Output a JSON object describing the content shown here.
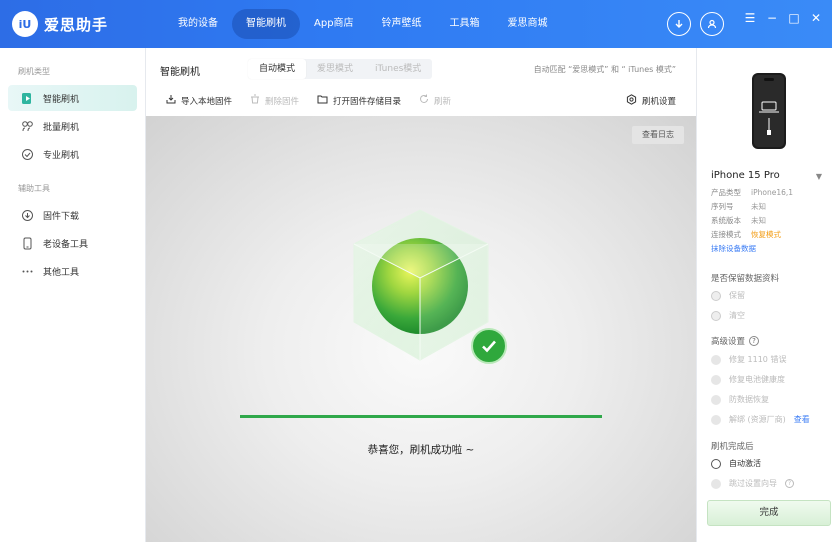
{
  "app": {
    "logo_badge": "iU",
    "name": "爱思助手",
    "nav_tabs": [
      "我的设备",
      "智能刷机",
      "App商店",
      "铃声壁纸",
      "工具箱",
      "爱思商城"
    ],
    "active_tab": "智能刷机",
    "accent": "#2f7af2"
  },
  "sidebar": {
    "section1": "刷机类型",
    "items1": [
      "智能刷机",
      "批量刷机",
      "专业刷机"
    ],
    "section2": "辅助工具",
    "items2": [
      "固件下载",
      "老设备工具",
      "其他工具"
    ]
  },
  "main": {
    "title": "智能刷机",
    "modes": [
      "自动模式",
      "爱思模式",
      "iTunes模式"
    ],
    "match_text": "自动匹配 “爱思模式” 和 “ iTunes 模式”",
    "tools": {
      "import": "导入本地固件",
      "delete": "删除固件",
      "open_dir": "打开固件存储目录",
      "refresh": "刷新"
    },
    "settings": "刷机设置",
    "view_log": "查看日志",
    "progress": 1.0,
    "success_text": "恭喜您，刷机成功啦 ~"
  },
  "device": {
    "name": "iPhone 15 Pro",
    "info": [
      {
        "k": "产品类型",
        "v": "iPhone16,1"
      },
      {
        "k": "序列号",
        "v": "未知"
      },
      {
        "k": "系统版本",
        "v": "未知"
      },
      {
        "k": "连接模式",
        "v": "恢复模式"
      }
    ],
    "erase_link": "抹除设备数据",
    "keep_data_label": "是否保留数据资料",
    "keep": "保留",
    "clear": "清空",
    "advanced_label": "高级设置",
    "advanced_opts": [
      "修复 1110 错误",
      "修复电池健康度",
      "防数据恢复",
      "解绑 (资源厂商)"
    ],
    "view": "查看",
    "after_label": "刷机完成后",
    "auto_activate": "自动激活",
    "skip_guide": "跳过设置向导",
    "done_button": "完成"
  }
}
